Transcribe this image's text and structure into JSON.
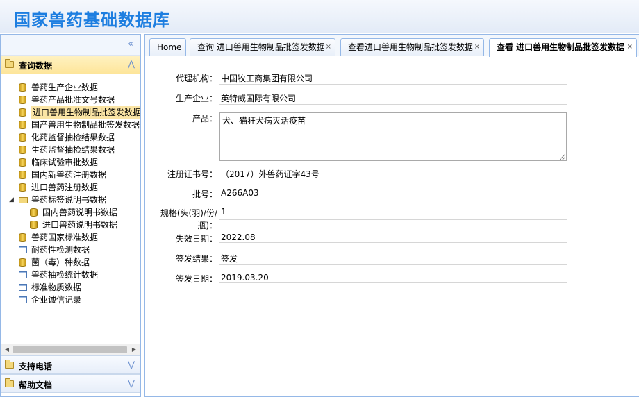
{
  "app": {
    "title": "国家兽药基础数据库"
  },
  "sidebar": {
    "collapse_glyph": "«",
    "query_section": {
      "label": "查询数据",
      "arrow": "⋀"
    },
    "tree": [
      {
        "label": "兽药生产企业数据",
        "icon": "database-icon",
        "level": 1
      },
      {
        "label": "兽药产品批准文号数据",
        "icon": "database-icon",
        "level": 1
      },
      {
        "label": "进口兽用生物制品批签发数据",
        "icon": "database-icon",
        "level": 1,
        "selected": true
      },
      {
        "label": "国产兽用生物制品批签发数据",
        "icon": "database-icon",
        "level": 1
      },
      {
        "label": "化药监督抽检结果数据",
        "icon": "database-icon",
        "level": 1
      },
      {
        "label": "生药监督抽检结果数据",
        "icon": "database-icon",
        "level": 1
      },
      {
        "label": "临床试验审批数据",
        "icon": "database-icon",
        "level": 1
      },
      {
        "label": "国内新兽药注册数据",
        "icon": "database-icon",
        "level": 1
      },
      {
        "label": "进口兽药注册数据",
        "icon": "database-icon",
        "level": 1
      },
      {
        "label": "兽药标签说明书数据",
        "icon": "folder-icon",
        "level": 1,
        "expanded": true
      },
      {
        "label": "国内兽药说明书数据",
        "icon": "database-icon",
        "level": 2
      },
      {
        "label": "进口兽药说明书数据",
        "icon": "database-icon",
        "level": 2
      },
      {
        "label": "兽药国家标准数据",
        "icon": "database-icon",
        "level": 1
      },
      {
        "label": "耐药性检测数据",
        "icon": "page-icon",
        "level": 1
      },
      {
        "label": "菌（毒）种数据",
        "icon": "database-icon",
        "level": 1
      },
      {
        "label": "兽药抽检统计数据",
        "icon": "page-icon",
        "level": 1
      },
      {
        "label": "标准物质数据",
        "icon": "page-icon",
        "level": 1
      },
      {
        "label": "企业诚信记录",
        "icon": "page-icon",
        "level": 1
      }
    ],
    "support_section": {
      "label": "支持电话",
      "arrow": "⋁"
    },
    "help_section": {
      "label": "帮助文档",
      "arrow": "⋁"
    }
  },
  "tabs": [
    {
      "label": "Home",
      "closable": false
    },
    {
      "label": "查询 进口兽用生物制品批签发数据",
      "closable": true
    },
    {
      "label": "查看进口兽用生物制品批签发数据",
      "closable": true
    },
    {
      "label": "查看 进口兽用生物制品批签发数据",
      "closable": true,
      "active": true
    }
  ],
  "close_glyph": "×",
  "detail": {
    "agency": {
      "label": "代理机构：",
      "value": "中国牧工商集团有限公司"
    },
    "manufacturer": {
      "label": "生产企业：",
      "value": "英特威国际有限公司"
    },
    "product": {
      "label": "产品：",
      "value": "犬、猫狂犬病灭活疫苗"
    },
    "cert_no": {
      "label": "注册证书号：",
      "value": "（2017）外兽药证字43号"
    },
    "batch_no": {
      "label": "批号：",
      "value": "A266A03"
    },
    "spec": {
      "label_line1": "规格(头(羽)/份/",
      "label_line2": "瓶)：",
      "value": "1"
    },
    "expiry": {
      "label": "失效日期：",
      "value": "2022.08"
    },
    "result": {
      "label": "签发结果：",
      "value": "签发"
    },
    "issue_date": {
      "label": "签发日期：",
      "value": "2019.03.20"
    }
  }
}
